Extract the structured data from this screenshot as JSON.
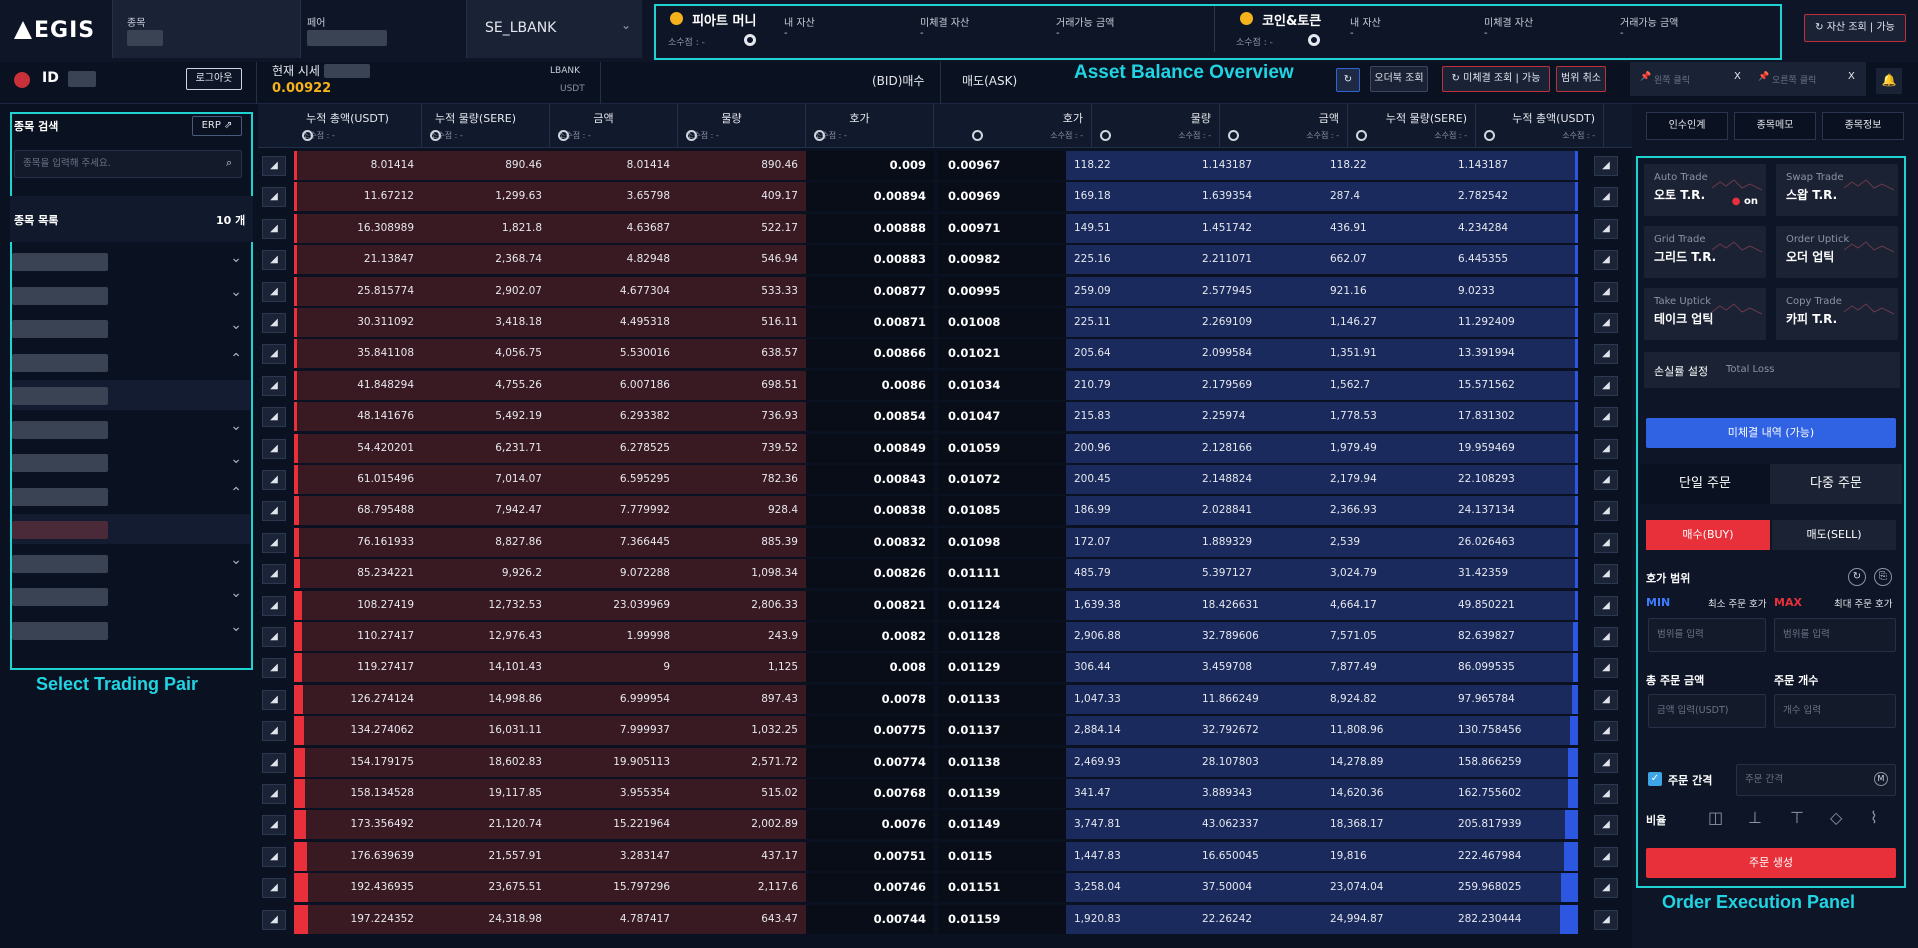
{
  "header": {
    "logo": "EGIS",
    "item_label": "종목",
    "pair_label": "페어",
    "exchange": "SE_LBANK",
    "fiat": {
      "title": "피아트 머니",
      "decimal": "소수점 : -",
      "my_asset": "내 자산",
      "my_asset_val": "-",
      "unfilled": "미체결 자산",
      "unfilled_val": "-",
      "tradable": "거래가능 금액",
      "tradable_val": "-"
    },
    "coin": {
      "title": "코인&토큰",
      "decimal": "소수점 : -",
      "my_asset": "내 자산",
      "my_asset_val": "-",
      "unfilled": "미체결 자산",
      "unfilled_val": "-",
      "tradable": "거래가능 금액",
      "tradable_val": "-"
    },
    "asset_query_btn": "자산 조회 | 가능"
  },
  "annotations": {
    "balance": "Asset Balance Overview",
    "pair": "Select Trading Pair",
    "order": "Order Execution Panel"
  },
  "sub": {
    "id_label": "ID",
    "logout": "로그아웃",
    "price_label": "현재 시세",
    "price": "0.00922",
    "exchange": "LBANK",
    "currency": "USDT",
    "bid": "(BID)매수",
    "ask": "매도(ASK)",
    "orderbook_btn": "오더북 조회",
    "unfilled_btn": "미체결 조회 | 가능",
    "cancel_range": "범위 취소",
    "tab_left": "왼쪽 클릭",
    "tab_right": "오른쪽 클릭",
    "tab_close": "X"
  },
  "left": {
    "search_title": "종목 검색",
    "erp": "ERP",
    "search_placeholder": "종목을 입력해 주세요.",
    "list_title": "종목 목록",
    "count": "10 개"
  },
  "table": {
    "headers_left": [
      "누적 총액(USDT)",
      "누적 물량(SERE)",
      "금액",
      "물량",
      "호가"
    ],
    "headers_right": [
      "호가",
      "물량",
      "금액",
      "누적 물량(SERE)",
      "누적 총액(USDT)"
    ],
    "decimal": "소수점 : -",
    "bids": [
      [
        "8.01414",
        "890.46",
        "8.01414",
        "890.46",
        "0.009"
      ],
      [
        "11.67212",
        "1,299.63",
        "3.65798",
        "409.17",
        "0.00894"
      ],
      [
        "16.308989",
        "1,821.8",
        "4.63687",
        "522.17",
        "0.00888"
      ],
      [
        "21.13847",
        "2,368.74",
        "4.82948",
        "546.94",
        "0.00883"
      ],
      [
        "25.815774",
        "2,902.07",
        "4.677304",
        "533.33",
        "0.00877"
      ],
      [
        "30.311092",
        "3,418.18",
        "4.495318",
        "516.11",
        "0.00871"
      ],
      [
        "35.841108",
        "4,056.75",
        "5.530016",
        "638.57",
        "0.00866"
      ],
      [
        "41.848294",
        "4,755.26",
        "6.007186",
        "698.51",
        "0.0086"
      ],
      [
        "48.141676",
        "5,492.19",
        "6.293382",
        "736.93",
        "0.00854"
      ],
      [
        "54.420201",
        "6,231.71",
        "6.278525",
        "739.52",
        "0.00849"
      ],
      [
        "61.015496",
        "7,014.07",
        "6.595295",
        "782.36",
        "0.00843"
      ],
      [
        "68.795488",
        "7,942.47",
        "7.779992",
        "928.4",
        "0.00838"
      ],
      [
        "76.161933",
        "8,827.86",
        "7.366445",
        "885.39",
        "0.00832"
      ],
      [
        "85.234221",
        "9,926.2",
        "9.072288",
        "1,098.34",
        "0.00826"
      ],
      [
        "108.27419",
        "12,732.53",
        "23.039969",
        "2,806.33",
        "0.00821"
      ],
      [
        "110.27417",
        "12,976.43",
        "1.99998",
        "243.9",
        "0.0082"
      ],
      [
        "119.27417",
        "14,101.43",
        "9",
        "1,125",
        "0.008"
      ],
      [
        "126.274124",
        "14,998.86",
        "6.999954",
        "897.43",
        "0.0078"
      ],
      [
        "134.274062",
        "16,031.11",
        "7.999937",
        "1,032.25",
        "0.00775"
      ],
      [
        "154.179175",
        "18,602.83",
        "19.905113",
        "2,571.72",
        "0.00774"
      ],
      [
        "158.134528",
        "19,117.85",
        "3.955354",
        "515.02",
        "0.00768"
      ],
      [
        "173.356492",
        "21,120.74",
        "15.221964",
        "2,002.89",
        "0.0076"
      ],
      [
        "176.639639",
        "21,557.91",
        "3.283147",
        "437.17",
        "0.00751"
      ],
      [
        "192.436935",
        "23,675.51",
        "15.797296",
        "2,117.6",
        "0.00746"
      ],
      [
        "197.224352",
        "24,318.98",
        "4.787417",
        "643.47",
        "0.00744"
      ]
    ],
    "asks": [
      [
        "0.00967",
        "118.22",
        "1.143187",
        "118.22",
        "1.143187"
      ],
      [
        "0.00969",
        "169.18",
        "1.639354",
        "287.4",
        "2.782542"
      ],
      [
        "0.00971",
        "149.51",
        "1.451742",
        "436.91",
        "4.234284"
      ],
      [
        "0.00982",
        "225.16",
        "2.211071",
        "662.07",
        "6.445355"
      ],
      [
        "0.00995",
        "259.09",
        "2.577945",
        "921.16",
        "9.0233"
      ],
      [
        "0.01008",
        "225.11",
        "2.269109",
        "1,146.27",
        "11.292409"
      ],
      [
        "0.01021",
        "205.64",
        "2.099584",
        "1,351.91",
        "13.391994"
      ],
      [
        "0.01034",
        "210.79",
        "2.179569",
        "1,562.7",
        "15.571562"
      ],
      [
        "0.01047",
        "215.83",
        "2.25974",
        "1,778.53",
        "17.831302"
      ],
      [
        "0.01059",
        "200.96",
        "2.128166",
        "1,979.49",
        "19.959469"
      ],
      [
        "0.01072",
        "200.45",
        "2.148824",
        "2,179.94",
        "22.108293"
      ],
      [
        "0.01085",
        "186.99",
        "2.028841",
        "2,366.93",
        "24.137134"
      ],
      [
        "0.01098",
        "172.07",
        "1.889329",
        "2,539",
        "26.026463"
      ],
      [
        "0.01111",
        "485.79",
        "5.397127",
        "3,024.79",
        "31.42359"
      ],
      [
        "0.01124",
        "1,639.38",
        "18.426631",
        "4,664.17",
        "49.850221"
      ],
      [
        "0.01128",
        "2,906.88",
        "32.789606",
        "7,571.05",
        "82.639827"
      ],
      [
        "0.01129",
        "306.44",
        "3.459708",
        "7,877.49",
        "86.099535"
      ],
      [
        "0.01133",
        "1,047.33",
        "11.866249",
        "8,924.82",
        "97.965784"
      ],
      [
        "0.01137",
        "2,884.14",
        "32.792672",
        "11,808.96",
        "130.758456"
      ],
      [
        "0.01138",
        "2,469.93",
        "28.107803",
        "14,278.89",
        "158.866259"
      ],
      [
        "0.01139",
        "341.47",
        "3.889343",
        "14,620.36",
        "162.755602"
      ],
      [
        "0.01149",
        "3,747.81",
        "43.062337",
        "18,368.17",
        "205.817939"
      ],
      [
        "0.0115",
        "1,447.83",
        "16.650045",
        "19,816",
        "222.467984"
      ],
      [
        "0.01151",
        "3,258.04",
        "37.50004",
        "23,074.04",
        "259.968025"
      ],
      [
        "0.01159",
        "1,920.83",
        "22.26242",
        "24,994.87",
        "282.230444"
      ]
    ]
  },
  "right": {
    "info_tabs": [
      "인수인계",
      "종목메모",
      "종목정보"
    ],
    "cards": [
      {
        "en": "Auto Trade",
        "ko": "오토 T.R.",
        "badge": "on"
      },
      {
        "en": "Swap Trade",
        "ko": "스왑 T.R."
      },
      {
        "en": "Grid Trade",
        "ko": "그리드 T.R."
      },
      {
        "en": "Order Uptick",
        "ko": "오더 업틱"
      },
      {
        "en": "Take Uptick",
        "ko": "테이크 업틱"
      },
      {
        "en": "Copy Trade",
        "ko": "카피 T.R."
      }
    ],
    "loss_ko": "손실률 설정",
    "loss_en": "Total Loss",
    "unfilled_history": "미체결 내역 (가능)",
    "single": "단일 주문",
    "multi": "다중 주문",
    "buy": "매수(BUY)",
    "sell": "매도(SELL)",
    "range_title": "호가 범위",
    "min": "MIN",
    "min_label": "최소 주문 호가",
    "max": "MAX",
    "max_label": "최대 주문 호가",
    "range_placeholder": "범위를 입력",
    "total_label": "총 주문 금액",
    "count_label": "주문 개수",
    "total_placeholder": "금액 입력(USDT)",
    "count_placeholder": "개수 입력",
    "interval_label": "주문 간격",
    "interval_placeholder": "주문 간격",
    "ratio_label": "비율",
    "create": "주문 생성"
  },
  "colors": {
    "accent": "#1fd3d3",
    "buy": "#e8303a",
    "ask_blue": "#2d57e0",
    "yellow": "#f5b21b"
  }
}
